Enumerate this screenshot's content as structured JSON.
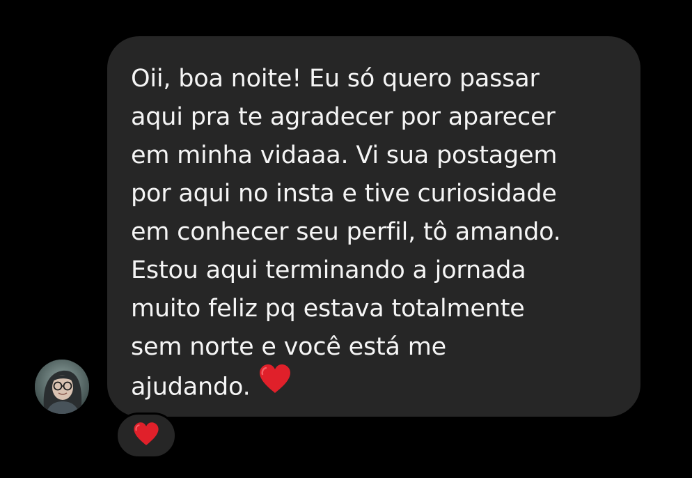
{
  "message": {
    "lines": [
      "Oii, boa noite! Eu só quero passar",
      "aqui pra te agradecer por aparecer",
      "em minha vidaaa. Vi sua postagem",
      "por aqui no insta e tive curiosidade",
      "em conhecer seu perfil, tô amando.",
      "Estou aqui terminando a jornada",
      "muito feliz pq estava totalmente",
      "sem norte e você está me",
      "ajudando."
    ],
    "trailing_icon": "red-heart-emoji"
  },
  "reaction": {
    "icon": "red-heart-emoji"
  },
  "avatar": {
    "icon": "user-profile-photo"
  },
  "colors": {
    "background": "#000000",
    "bubble": "#262626",
    "text": "#f5f5f5",
    "heart": "#e0202a"
  }
}
